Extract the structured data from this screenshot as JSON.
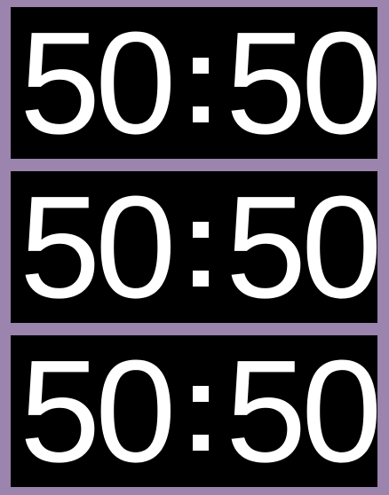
{
  "colors": {
    "background": "#9b84ad",
    "panel": "#000000",
    "digits": "#ffffff"
  },
  "displays": [
    {
      "left": "50",
      "separator": ":",
      "right": "50"
    },
    {
      "left": "50",
      "separator": ":",
      "right": "50"
    },
    {
      "left": "50",
      "separator": ":",
      "right": "50"
    }
  ]
}
